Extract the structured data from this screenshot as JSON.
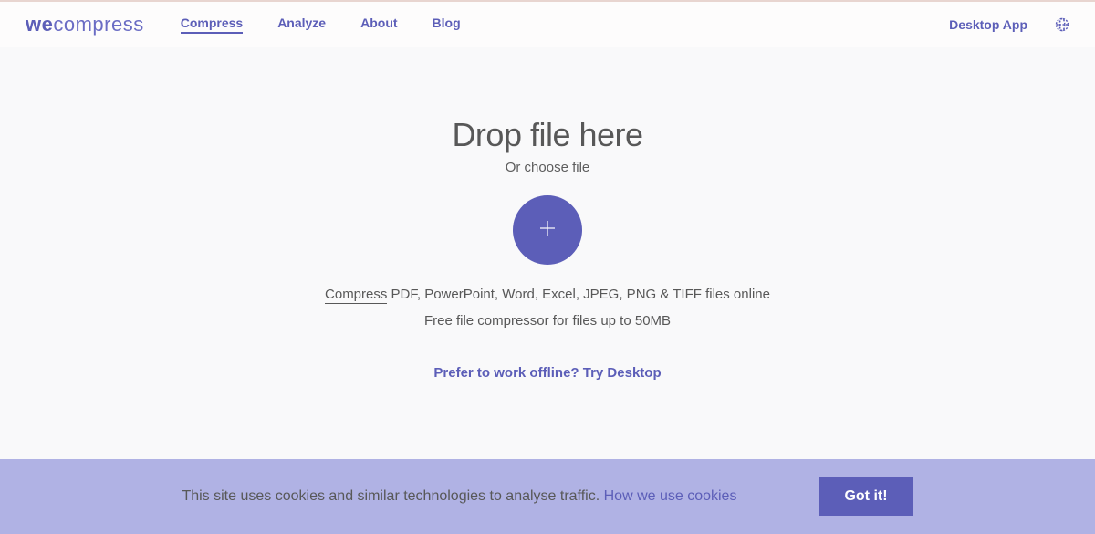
{
  "logo": {
    "we": "we",
    "compress": "compress"
  },
  "nav": {
    "compress": "Compress",
    "analyze": "Analyze",
    "about": "About",
    "blog": "Blog"
  },
  "header_right": {
    "desktop_app": "Desktop App"
  },
  "main": {
    "drop_title": "Drop file here",
    "choose_file": "Or choose file",
    "desc_word": "Compress",
    "desc_rest": " PDF, PowerPoint, Word, Excel, JPEG, PNG & TIFF files online",
    "desc_line2": "Free file compressor for files up to 50MB",
    "offline_link": "Prefer to work offline? Try Desktop"
  },
  "cookie": {
    "text": "This site uses cookies and similar technologies to analyse traffic. ",
    "link": "How we use cookies",
    "button": "Got it!"
  }
}
